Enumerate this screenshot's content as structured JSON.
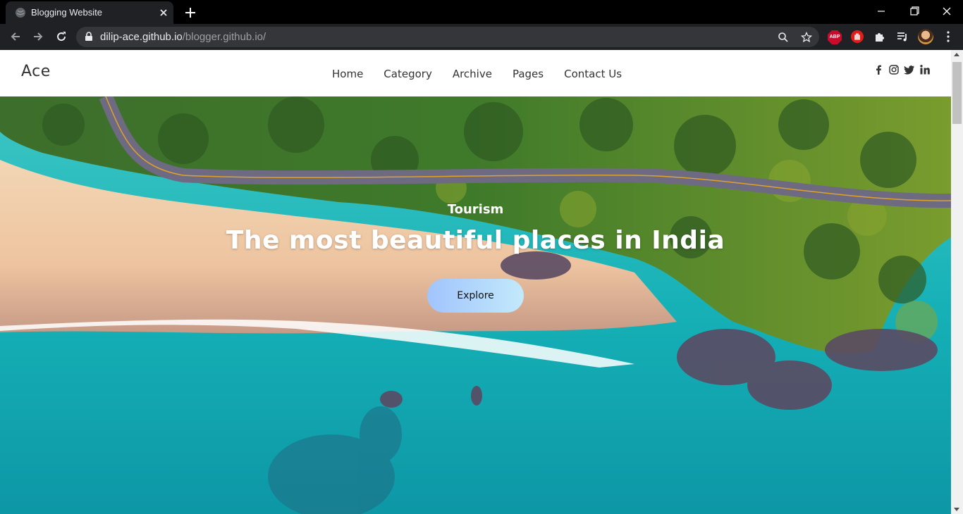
{
  "browser": {
    "tab_title": "Blogging Website",
    "url_host": "dilip-ace.github.io",
    "url_path": "/blogger.github.io/",
    "extensions": {
      "adblock_label": "ABP"
    }
  },
  "site": {
    "logo": "Ace",
    "nav": [
      {
        "label": "Home"
      },
      {
        "label": "Category"
      },
      {
        "label": "Archive"
      },
      {
        "label": "Pages"
      },
      {
        "label": "Contact Us"
      }
    ],
    "socials": [
      "facebook-icon",
      "instagram-icon",
      "twitter-icon",
      "linkedin-icon"
    ]
  },
  "hero": {
    "kicker": "Tourism",
    "title": "The most beautiful places in India",
    "button_label": "Explore"
  },
  "colors": {
    "chrome_bg": "#000000",
    "toolbar_bg": "#202124",
    "omnibox_bg": "#35363a",
    "button_gradient_start": "#a1c4fd",
    "button_gradient_end": "#c2e9fb"
  }
}
